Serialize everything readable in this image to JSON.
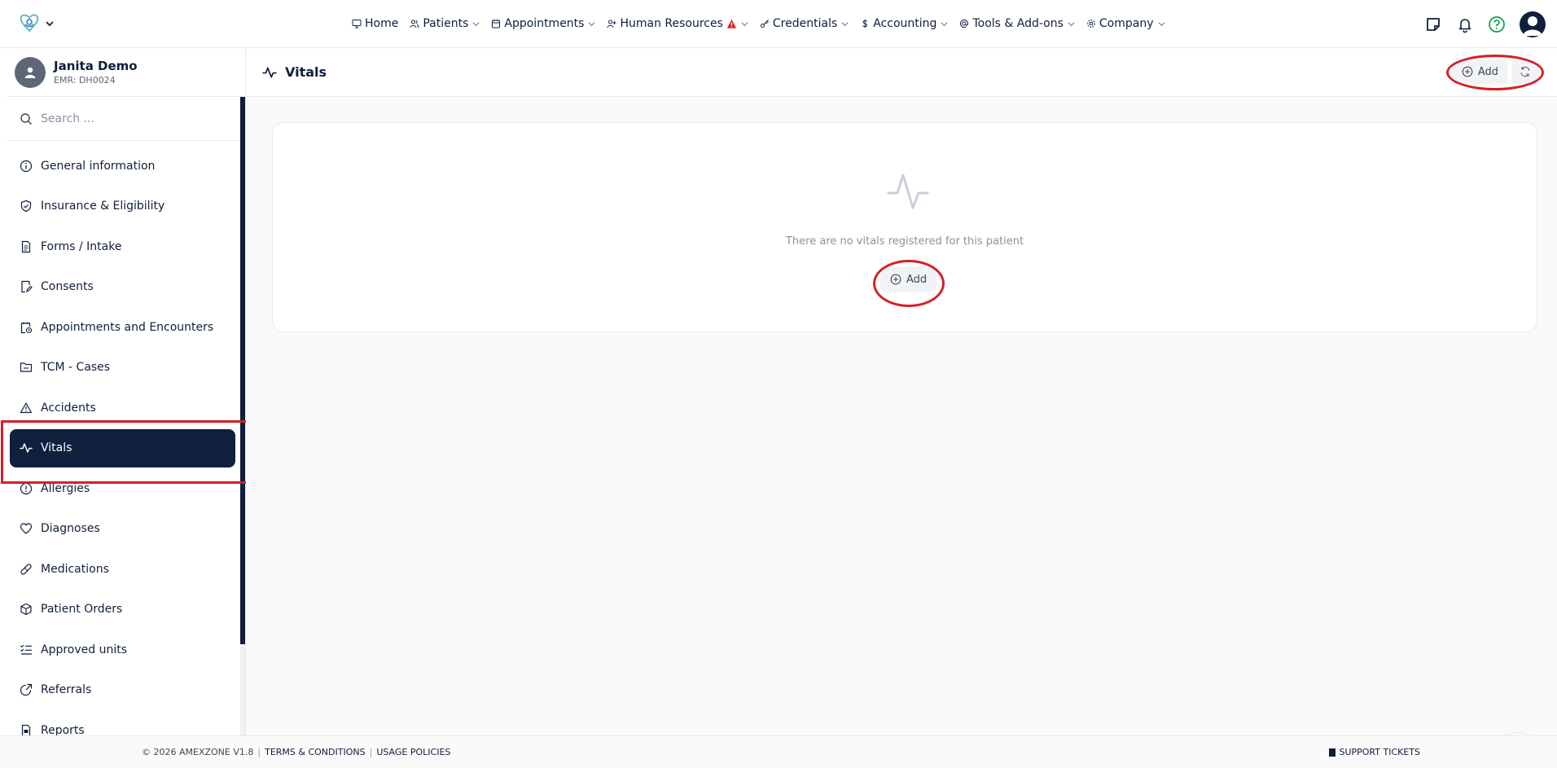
{
  "nav": {
    "items": [
      {
        "label": "Home",
        "icon": "monitor-icon"
      },
      {
        "label": "Patients",
        "icon": "users-icon"
      },
      {
        "label": "Appointments",
        "icon": "calendar-icon"
      },
      {
        "label": "Human Resources",
        "icon": "user-plus-icon"
      },
      {
        "label": "Credentials",
        "icon": "key-icon"
      },
      {
        "label": "Accounting",
        "icon": "dollar-icon"
      },
      {
        "label": "Tools & Add-ons",
        "icon": "at-icon"
      },
      {
        "label": "Company",
        "icon": "gear-icon"
      }
    ]
  },
  "patient": {
    "name": "Janita Demo",
    "emr": "EMR: DH0024"
  },
  "sidebar": {
    "search_placeholder": "Search ...",
    "items": [
      {
        "label": "General information",
        "icon": "info-icon"
      },
      {
        "label": "Insurance & Eligibility",
        "icon": "shield-check-icon"
      },
      {
        "label": "Forms / Intake",
        "icon": "document-icon"
      },
      {
        "label": "Consents",
        "icon": "edit-document-icon"
      },
      {
        "label": "Appointments and Encounters",
        "icon": "calendar-clock-icon"
      },
      {
        "label": "TCM - Cases",
        "icon": "folder-icon"
      },
      {
        "label": "Accidents",
        "icon": "warning-icon"
      },
      {
        "label": "Vitals",
        "icon": "activity-icon"
      },
      {
        "label": "Allergies",
        "icon": "alert-circle-icon"
      },
      {
        "label": "Diagnoses",
        "icon": "heart-icon"
      },
      {
        "label": "Medications",
        "icon": "pill-icon"
      },
      {
        "label": "Patient Orders",
        "icon": "box-icon"
      },
      {
        "label": "Approved units",
        "icon": "checklist-icon"
      },
      {
        "label": "Referrals",
        "icon": "external-link-icon"
      },
      {
        "label": "Reports",
        "icon": "report-icon"
      }
    ]
  },
  "main": {
    "title": "Vitals",
    "add_label": "Add",
    "empty_text": "There are no vitals registered for this patient",
    "card_add_label": "Add"
  },
  "footer": {
    "copyright": "© 2026 AMEXZONE V1.8",
    "sep": "|",
    "terms": "TERMS & CONDITIONS",
    "usage": "USAGE POLICIES",
    "support": "SUPPORT TICKETS"
  },
  "colors": {
    "primary": "#0f1f3d",
    "annotation": "#d61f26",
    "help": "#1aa34a"
  }
}
